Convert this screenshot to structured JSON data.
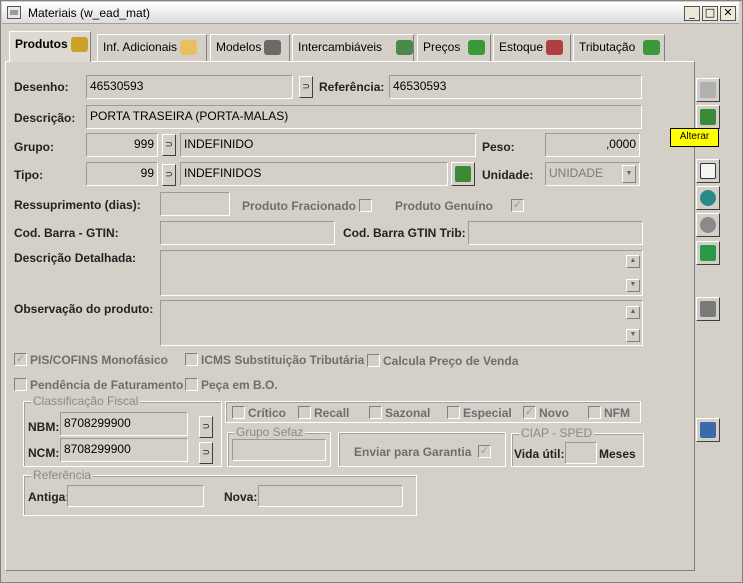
{
  "window": {
    "title": "Materiais (w_ead_mat)",
    "min": "_",
    "max": "□",
    "close": "✕"
  },
  "tabs": [
    {
      "label": "Produtos",
      "active": true
    },
    {
      "label": "Inf. Adicionais"
    },
    {
      "label": "Modelos"
    },
    {
      "label": "Intercambiáveis"
    },
    {
      "label": "Preços"
    },
    {
      "label": "Estoque"
    },
    {
      "label": "Tributação"
    }
  ],
  "form": {
    "desenho_label": "Desenho:",
    "desenho": "46530593",
    "referencia_label": "Referência:",
    "referencia": "46530593",
    "descricao_label": "Descrição:",
    "descricao": "PORTA TRASEIRA (PORTA-MALAS)",
    "grupo_label": "Grupo:",
    "grupo_code": "999",
    "grupo_desc": "INDEFINIDO",
    "peso_label": "Peso:",
    "peso": ",0000",
    "tipo_label": "Tipo:",
    "tipo_code": "99",
    "tipo_desc": "INDEFINIDOS",
    "unidade_label": "Unidade:",
    "unidade": "UNIDADE",
    "ressup_label": "Ressuprimento (dias):",
    "ressup": "",
    "fracionado_label": "Produto Fracionado",
    "fracionado": false,
    "genuino_label": "Produto Genuíno",
    "genuino": true,
    "gtin_label": "Cod. Barra - GTIN:",
    "gtin": "",
    "gtin_trib_label": "Cod. Barra GTIN Trib:",
    "gtin_trib": "",
    "desc_det_label": "Descrição Detalhada:",
    "obs_label": "Observação do produto:",
    "pis_label": "PIS/COFINS Monofásico",
    "pis": true,
    "icms_label": "ICMS Substituição Tributária",
    "icms": false,
    "calc_label": "Calcula Preço de Venda",
    "calc": false,
    "pend_label": "Pendência de Faturamento",
    "pend": false,
    "peca_label": "Peça em B.O.",
    "peca": false
  },
  "fiscal": {
    "group_label": "Classificação Fiscal",
    "nbm_label": "NBM:",
    "nbm": "8708299900",
    "ncm_label": "NCM:",
    "ncm": "8708299900"
  },
  "flags": [
    {
      "label": "Crítico",
      "checked": false
    },
    {
      "label": "Recall",
      "checked": false
    },
    {
      "label": "Sazonal",
      "checked": false
    },
    {
      "label": "Especial",
      "checked": false
    },
    {
      "label": "Novo",
      "checked": true
    },
    {
      "label": "NFM",
      "checked": false
    }
  ],
  "sefaz": {
    "group_label": "Grupo Sefaz",
    "value": ""
  },
  "garantia": {
    "label": "Enviar para Garantia",
    "checked": true
  },
  "ciap": {
    "group_label": "CIAP - SPED",
    "vida_label": "Vida útil:",
    "vida": "",
    "meses_label": "Meses"
  },
  "ref": {
    "group_label": "Referência",
    "antiga_label": "Antiga:",
    "antiga": "",
    "nova_label": "Nova:",
    "nova": ""
  },
  "toolbar": {
    "tooltip": "Alterar"
  },
  "colors": {
    "tooltip": "#ffff00",
    "window_bg": "#d4d0c8"
  }
}
